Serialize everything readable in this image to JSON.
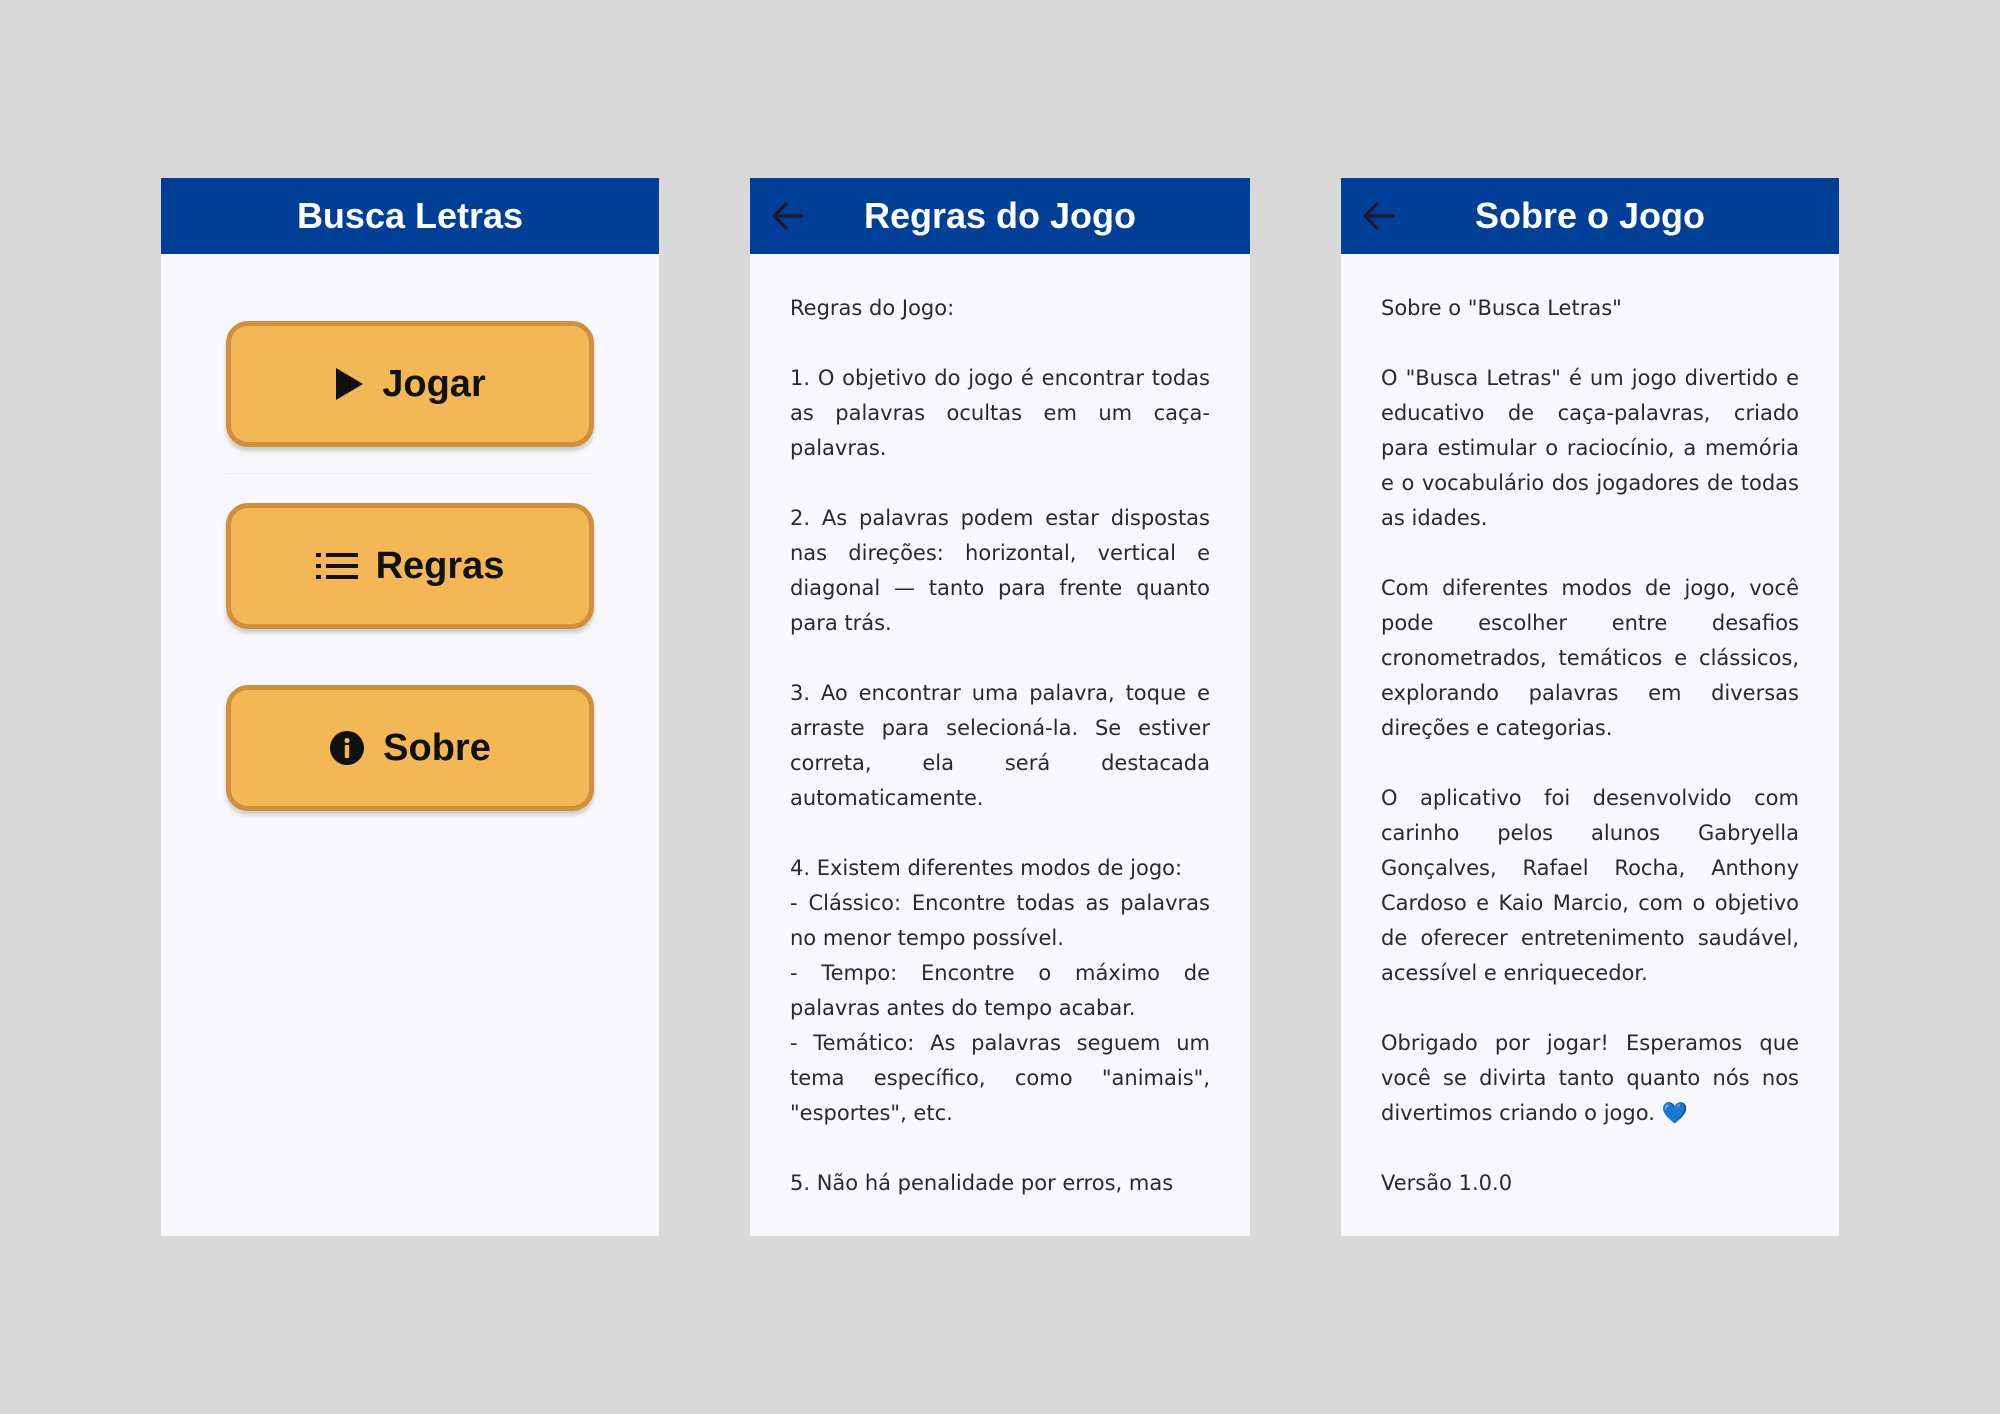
{
  "home": {
    "title": "Busca Letras",
    "buttons": {
      "play": "Jogar",
      "rules": "Regras",
      "about": "Sobre"
    },
    "icons": {
      "play": "play-icon",
      "rules": "list-icon",
      "about": "info-icon"
    }
  },
  "rules": {
    "title": "Regras do Jogo",
    "back_icon": "arrow-back-icon",
    "heading": "Regras do Jogo:",
    "rule1": "1. O objetivo do jogo é encontrar todas as palavras ocultas em um caça-palavras.",
    "rule2": "2. As palavras podem estar dispostas nas direções: horizontal, vertical e diagonal — tanto para frente quanto para trás.",
    "rule3": "3. Ao encontrar uma palavra, toque e arraste para selecioná-la. Se estiver correta, ela será destacada automaticamente.",
    "rule4": "4. Existem diferentes modos de jogo:",
    "mode_classic": "- Clássico: Encontre todas as palavras no menor tempo possível.",
    "mode_time": "- Tempo: Encontre o máximo de palavras antes do tempo acabar.",
    "mode_thematic": "- Temático: As palavras seguem um tema específico, como \"animais\", \"esportes\", etc.",
    "rule5": "5. Não há penalidade por erros, mas"
  },
  "about": {
    "title": "Sobre o Jogo",
    "back_icon": "arrow-back-icon",
    "heading": "Sobre o \"Busca Letras\"",
    "p1": "O \"Busca Letras\" é um jogo divertido e educativo de caça-palavras, criado para estimular o raciocínio, a memória e o vocabulário dos jogadores de todas as idades.",
    "p2": "Com diferentes modos de jogo, você pode escolher entre desafios cronometrados, temáticos e clássicos, explorando palavras em diversas direções e categorias.",
    "p3": "O aplicativo foi desenvolvido com carinho pelos alunos Gabryella Gonçalves, Rafael Rocha, Anthony Cardoso e Kaio Marcio, com o objetivo de oferecer entretenimento saudável, acessível e enriquecedor.",
    "p4": "Obrigado por jogar! Esperamos que você se divirta tanto quanto nós nos divertimos criando o jogo. 💙",
    "version": "Versão 1.0.0"
  },
  "colors": {
    "background": "#d9d9d9",
    "appbar": "#003f98",
    "screen": "#f7f7fc",
    "button_fill": "#f4b755",
    "button_border": "#d0903a",
    "text": "#2a2a2e"
  }
}
